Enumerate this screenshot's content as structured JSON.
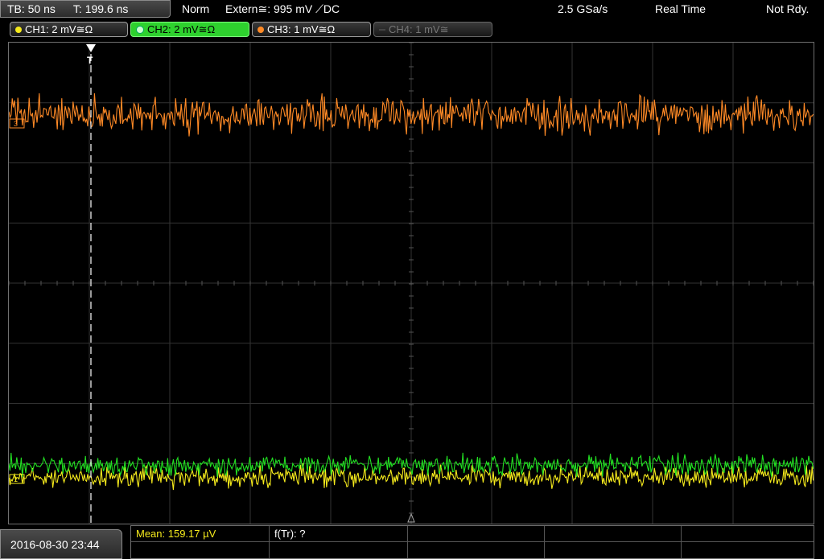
{
  "header": {
    "timebase": "TB: 50 ns",
    "trigger_time": "T: 199.6 ns",
    "mode": "Norm",
    "trigger": "Extern≅: 995 mV ⟋DC",
    "sample_rate": "2.5 GSa/s",
    "acq_mode": "Real Time",
    "status": "Not Rdy."
  },
  "channels": [
    {
      "label": "CH1: 2 mV≅Ω",
      "color": "#f5ea1c"
    },
    {
      "label": "CH2: 2 mV≅Ω",
      "color": "#22e022"
    },
    {
      "label": "CH3: 1 mV≅Ω",
      "color": "#ff8a26"
    },
    {
      "label": "CH4: 1 mV≅",
      "color": "#777777"
    }
  ],
  "markers": {
    "trigger_marker": "T",
    "ch3_marker": "3",
    "ch1_marker": "1"
  },
  "footer": {
    "datetime": "2016-08-30 23:44",
    "measurement1": "Mean: 159.17 µV",
    "measurement2": "f(Tr): ?"
  }
}
